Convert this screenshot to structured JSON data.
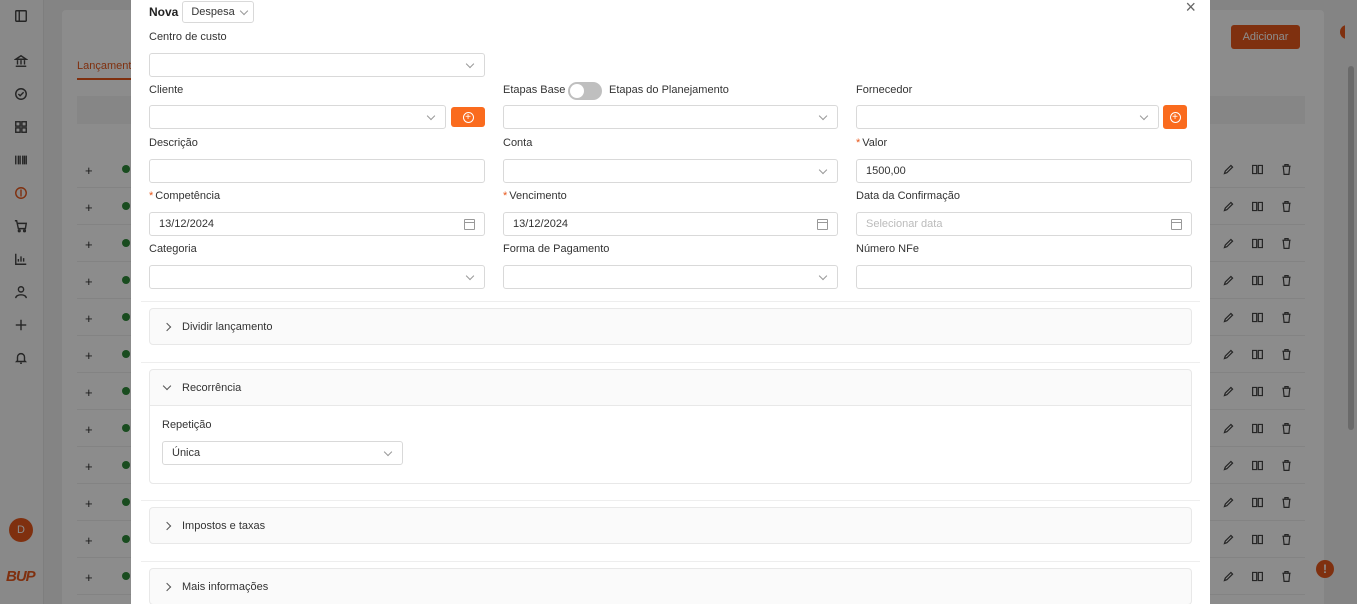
{
  "background": {
    "tab_label": "Lançamento",
    "add_button": "Adicionar",
    "help_badge": "!",
    "avatar_initial": "D",
    "logo_text": "BUP",
    "rows": 12,
    "sidebar_icons": [
      "sidebar-toggle-icon",
      "bank-icon",
      "check-circle-icon",
      "grid-icon",
      "barcode-icon",
      "dollar-icon",
      "cart-icon",
      "chart-icon",
      "user-icon",
      "plus-icon",
      "bell-icon"
    ]
  },
  "modal": {
    "title": "Nova",
    "type_select": "Despesa",
    "close_glyph": "×",
    "fields": {
      "centro_custo": {
        "label": "Centro de custo",
        "value": ""
      },
      "cliente": {
        "label": "Cliente",
        "value": ""
      },
      "etapas_base_label": "Etapas Base",
      "etapas_planejamento_label": "Etapas do Planejamento",
      "etapas": {
        "value": ""
      },
      "fornecedor": {
        "label": "Fornecedor",
        "value": ""
      },
      "descricao": {
        "label": "Descrição",
        "value": ""
      },
      "conta": {
        "label": "Conta",
        "value": ""
      },
      "valor": {
        "label": "Valor",
        "value": "1500,00",
        "required": true
      },
      "competencia": {
        "label": "Competência",
        "value": "13/12/2024",
        "required": true
      },
      "vencimento": {
        "label": "Vencimento",
        "value": "13/12/2024",
        "required": true
      },
      "data_confirmacao": {
        "label": "Data da Confirmação",
        "placeholder": "Selecionar data"
      },
      "categoria": {
        "label": "Categoria",
        "value": ""
      },
      "forma_pagamento": {
        "label": "Forma de Pagamento",
        "value": ""
      },
      "numero_nfe": {
        "label": "Número NFe",
        "value": ""
      }
    },
    "panels": {
      "dividir": {
        "label": "Dividir lançamento",
        "expanded": false
      },
      "recorrencia": {
        "label": "Recorrência",
        "expanded": true,
        "repeticao_label": "Repetição",
        "repeticao_value": "Única"
      },
      "impostos": {
        "label": "Impostos e taxas",
        "expanded": false
      },
      "mais_info": {
        "label": "Mais informações",
        "expanded": false
      }
    }
  },
  "colors": {
    "accent": "#e8581c",
    "button_orange": "#fa6b1e"
  }
}
